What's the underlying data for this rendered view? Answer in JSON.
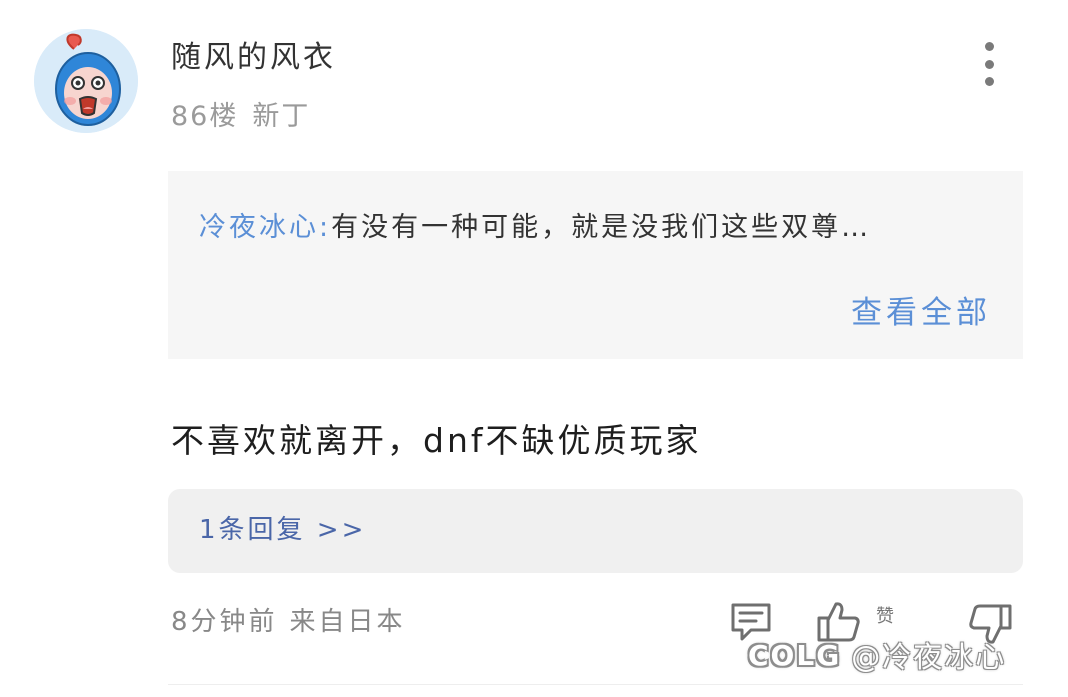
{
  "post": {
    "username": "随风的风衣",
    "floor": "86楼",
    "level": "新丁",
    "quote": {
      "author": "冷夜冰心:",
      "text": "有没有一种可能，就是没我们这些双尊…",
      "expand_label": "查看全部"
    },
    "comment": "不喜欢就离开，dnf不缺优质玩家",
    "replies_label": "1条回复 >>",
    "time": "8分钟前",
    "source": "来自日本",
    "like_label": "赞"
  },
  "watermark": {
    "logo": "COLG",
    "handle": "@冷夜冰心"
  },
  "icons": {
    "avatar": "cartoon-avatar",
    "more": "vertical-ellipsis-icon",
    "comment": "comment-icon",
    "like": "thumbs-up-icon",
    "dislike": "thumbs-down-icon"
  },
  "colors": {
    "link_blue": "#5b8fd6",
    "reply_blue": "#4a66a8",
    "quote_bg": "#f6f6f6",
    "reply_bg": "#f0f0f0",
    "avatar_bg": "#d9ebf9",
    "avatar_hood": "#2f86d8"
  }
}
